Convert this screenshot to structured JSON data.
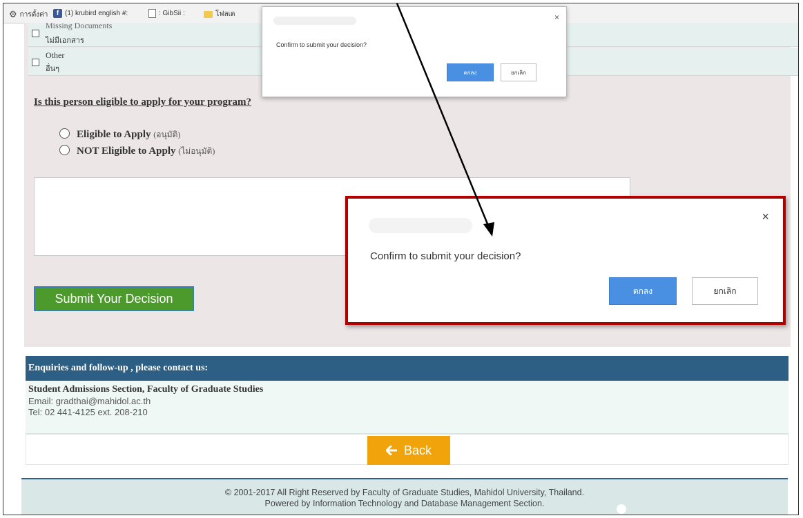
{
  "bookmarks": {
    "items": [
      {
        "label": "การตั้งค่า"
      },
      {
        "label": "(1) krubird english #:"
      },
      {
        "label": ": GibSii :"
      },
      {
        "label": "โฟลเด"
      }
    ]
  },
  "form": {
    "missing_docs_label": "Missing Documents",
    "missing_docs_thai": "ไม่มีเอกสาร",
    "other_label": "Other",
    "other_thai": "อื่นๆ",
    "question": "Is this person eligible to apply for your program?",
    "option_eligible": "Eligible to Apply",
    "option_eligible_thai": "(อนุมัติ)",
    "option_not_eligible": "NOT Eligible to Apply",
    "option_not_eligible_thai": "(ไม่อนุมัติ)",
    "submit_label": "Submit Your Decision"
  },
  "contact": {
    "header": "Enquiries and follow-up , please contact us:",
    "org": "Student Admissions Section, Faculty of Graduate Studies",
    "email": "Email: gradthai@mahidol.ac.th",
    "tel": "Tel: 02 441-4125 ext. 208-210"
  },
  "back_label": "Back",
  "footer": {
    "line1": "© 2001-2017 All Right Reserved by Faculty of Graduate Studies, Mahidol University, Thailand.",
    "line2": "Powered by Information Technology and Database Management Section."
  },
  "dialog_small": {
    "message": "Confirm to submit your decision?",
    "ok_label": "ตกลง",
    "cancel_label": "ยกเลิก",
    "close": "×"
  },
  "dialog_big": {
    "message": "Confirm to submit your decision?",
    "ok_label": "ตกลง",
    "cancel_label": "ยกเลิก",
    "close": "×"
  },
  "colors": {
    "submit_green": "#4b9a2b",
    "header_blue": "#2d5f85",
    "back_orange": "#f0a30a",
    "ok_blue": "#4a90e2",
    "highlight_red": "#b00000"
  }
}
